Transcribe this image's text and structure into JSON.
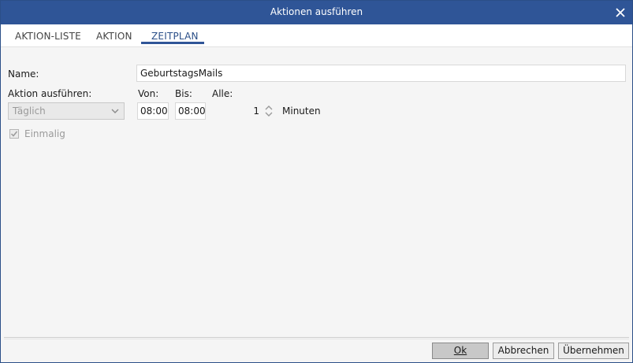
{
  "window": {
    "title": "Aktionen ausführen"
  },
  "tabs": [
    {
      "label": "AKTION-LISTE"
    },
    {
      "label": "AKTION"
    },
    {
      "label": "ZEITPLAN"
    }
  ],
  "form": {
    "name_label": "Name:",
    "name_value": "GeburtstagsMails",
    "run_label": "Aktion ausführen:",
    "run_value": "Täglich",
    "from_label": "Von:",
    "from_value": "08:00",
    "to_label": "Bis:",
    "to_value": "08:00",
    "every_label": "Alle:",
    "every_value": "1",
    "every_unit": "Minuten",
    "once_label": "Einmalig",
    "once_checked": true
  },
  "buttons": {
    "ok": "Ok",
    "cancel": "Abbrechen",
    "apply": "Übernehmen"
  }
}
